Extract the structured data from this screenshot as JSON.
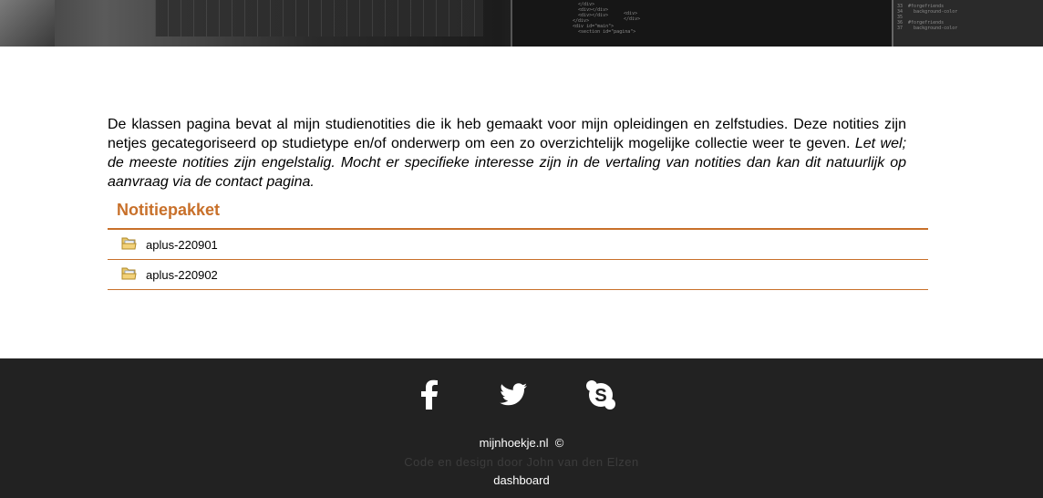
{
  "intro": {
    "text": "De klassen pagina bevat al mijn studienotities die ik heb gemaakt voor mijn opleidingen en zelfstudies. Deze notities zijn netjes gecategoriseerd op studietype en/of onderwerp om een zo overzichtelijk mogelijke collectie weer te geven.",
    "note": "Let wel; de meeste notities zijn engelstalig. Mocht er specifieke interesse zijn in de vertaling van notities dan kan dit natuurlijk op aanvraag via de contact pagina."
  },
  "package": {
    "title": "Notitiepakket",
    "items": [
      {
        "label": "aplus-220901",
        "icon": "folder-icon"
      },
      {
        "label": "aplus-220902",
        "icon": "folder-icon"
      }
    ]
  },
  "footer": {
    "social": [
      "facebook-icon",
      "twitter-icon",
      "skype-icon"
    ],
    "site": "mijnhoekje.nl",
    "copyright": "©",
    "credit": "Code en design door John van den Elzen",
    "dashboard": "dashboard"
  },
  "colors": {
    "accent": "#c8702a",
    "footer_bg": "#222222"
  }
}
